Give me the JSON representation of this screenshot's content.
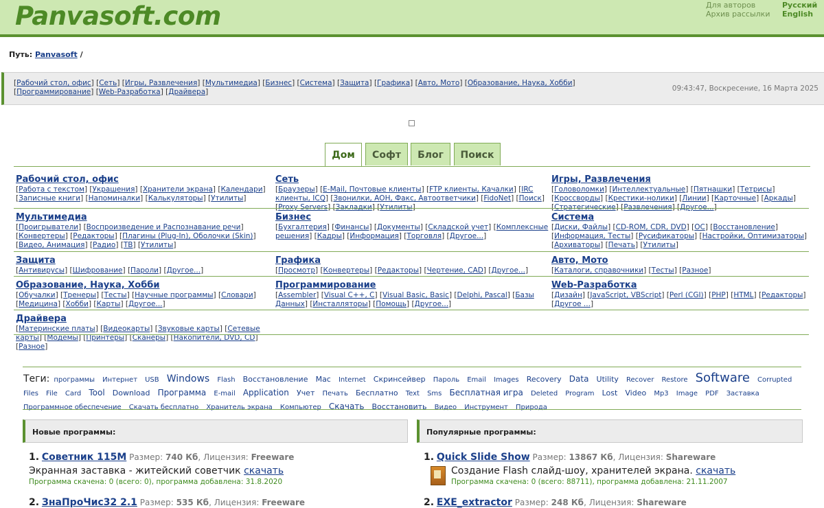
{
  "header": {
    "logo": "Panvasoft.com",
    "links": [
      "Для авторов",
      "Архив рассылки"
    ],
    "languages": [
      "Русский",
      "English"
    ]
  },
  "path": {
    "label": "Путь:",
    "link": "Panvasoft",
    "sep": "/"
  },
  "catbar": {
    "links": [
      "Рабочий стол, офис",
      "Сеть",
      "Игры, Развлечения",
      "Мультимедиа",
      "Бизнес",
      "Система",
      "Защита",
      "Графика",
      "Авто, Мото",
      "Образование, Наука, Хобби",
      "Программирование",
      "Web-Разработка",
      "Драйвера"
    ],
    "datetime": "09:43:47, Воскресение, 16 Марта 2025"
  },
  "tabs": [
    "Дом",
    "Софт",
    "Блог",
    "Поиск"
  ],
  "categories": [
    {
      "title": "Рабочий стол, офис",
      "items": [
        "Работа с текстом",
        "Украшения",
        "Хранители экрана",
        "Календари",
        "Записные книги",
        "Напоминалки",
        "Калькуляторы",
        "Утилиты"
      ]
    },
    {
      "title": "Сеть",
      "items": [
        "Браузеры",
        "E-Mail, Почтовые клиенты",
        "FTP клиенты, Качалки",
        "IRC клиенты, ICQ",
        "Звонилки, АОН, Факс, Автоответчики",
        "FidoNet",
        "Поиск",
        "Proxy Servers",
        "Закладки",
        "Утилиты"
      ]
    },
    {
      "title": "Игры, Развлечения",
      "items": [
        "Головоломки",
        "Интеллектуальные",
        "Пятнашки",
        "Тетрисы",
        "Кроссворды",
        "Крестики-нолики",
        "Линии",
        "Карточные",
        "Аркады",
        "Стратегические",
        "Развлечения",
        "Другое..."
      ]
    },
    {
      "title": "Мультимедиа",
      "items": [
        "Проигрыватели",
        "Воспроизведение и Распознавание речи",
        "Конвертеры",
        "Редакторы",
        "Плагины (Plug-In), Оболочки (Skin)",
        "Видео, Анимация",
        "Радио",
        "ТВ",
        "Утилиты"
      ]
    },
    {
      "title": "Бизнес",
      "items": [
        "Бухгалтерия",
        "Финансы",
        "Документы",
        "Складской учет",
        "Комплексные решения",
        "Кадры",
        "Информация",
        "Торговля",
        "Другое..."
      ]
    },
    {
      "title": "Система",
      "items": [
        "Диски, Файлы",
        "CD-ROM, CDR, DVD",
        "ОС",
        "Восстановление",
        "Информация, Тесты",
        "Русификаторы",
        "Настройки, Оптимизаторы",
        "Архиваторы",
        "Печать",
        "Утилиты"
      ]
    },
    {
      "title": "Защита",
      "items": [
        "Антивирусы",
        "Шифрование",
        "Пароли",
        "Другое..."
      ]
    },
    {
      "title": "Графика",
      "items": [
        "Просмотр",
        "Конвертеры",
        "Редакторы",
        "Чертение, CAD",
        "Другое..."
      ]
    },
    {
      "title": "Авто, Мото",
      "items": [
        "Каталоги, справочники",
        "Тесты",
        "Разное"
      ]
    },
    {
      "title": "Образование, Наука, Хобби",
      "items": [
        "Обучалки",
        "Тренеры",
        "Тесты",
        "Научные программы",
        "Словари",
        "Медицина",
        "Хобби",
        "Карты",
        "Другое..."
      ]
    },
    {
      "title": "Программирование",
      "items": [
        "Assembler",
        "Visual C++, C",
        "Visual Basic, Basic",
        "Delphi, Pascal",
        "Базы Данных",
        "Инсталляторы",
        "Помощь",
        "Другое..."
      ]
    },
    {
      "title": "Web-Разработка",
      "items": [
        "Дизайн",
        "JavaScript, VBScript",
        "Perl (CGI)",
        "PHP",
        "HTML",
        "Редакторы",
        "Другое ..."
      ]
    },
    {
      "title": "Драйвера",
      "items": [
        "Материнские платы",
        "Видеокарты",
        "Звуковые карты",
        "Сетевые карты",
        "Модемы",
        "Принтеры",
        "Сканеры",
        "Накопители, DVD, CD",
        "Разное"
      ]
    }
  ],
  "tags": {
    "label": "Теги:",
    "items": [
      {
        "t": "программы",
        "s": 10
      },
      {
        "t": "Интернет",
        "s": 10
      },
      {
        "t": "USB",
        "s": 10
      },
      {
        "t": "Windows",
        "s": 14
      },
      {
        "t": "Flash",
        "s": 10
      },
      {
        "t": "Восстановление",
        "s": 11
      },
      {
        "t": "Mac",
        "s": 11
      },
      {
        "t": "Internet",
        "s": 10
      },
      {
        "t": "Скринсейвер",
        "s": 11
      },
      {
        "t": "Пароль",
        "s": 10
      },
      {
        "t": "Email",
        "s": 10
      },
      {
        "t": "Images",
        "s": 10
      },
      {
        "t": "Recovery",
        "s": 11
      },
      {
        "t": "Data",
        "s": 12
      },
      {
        "t": "Utility",
        "s": 11
      },
      {
        "t": "Recover",
        "s": 10
      },
      {
        "t": "Restore",
        "s": 10
      },
      {
        "t": "Software",
        "s": 18
      },
      {
        "t": "Corrupted",
        "s": 10
      },
      {
        "t": "Files",
        "s": 10
      },
      {
        "t": "File",
        "s": 10
      },
      {
        "t": "Card",
        "s": 10
      },
      {
        "t": "Tool",
        "s": 12
      },
      {
        "t": "Download",
        "s": 11
      },
      {
        "t": "Программа",
        "s": 12
      },
      {
        "t": "E-mail",
        "s": 10
      },
      {
        "t": "Application",
        "s": 12
      },
      {
        "t": "Учет",
        "s": 11
      },
      {
        "t": "Печать",
        "s": 10
      },
      {
        "t": "Бесплатно",
        "s": 11
      },
      {
        "t": "Text",
        "s": 10
      },
      {
        "t": "Sms",
        "s": 10
      },
      {
        "t": "Бесплатная игра",
        "s": 12
      },
      {
        "t": "Deleted",
        "s": 10
      },
      {
        "t": "Program",
        "s": 10
      },
      {
        "t": "Lost",
        "s": 11
      },
      {
        "t": "Video",
        "s": 11
      },
      {
        "t": "Mp3",
        "s": 10
      },
      {
        "t": "Image",
        "s": 10
      },
      {
        "t": "PDF",
        "s": 10
      },
      {
        "t": "Заставка",
        "s": 10
      },
      {
        "t": "Программное обеспечение",
        "s": 10
      },
      {
        "t": "Скачать бесплатно",
        "s": 10
      },
      {
        "t": "Хранитель экрана",
        "s": 10
      },
      {
        "t": "Компьютер",
        "s": 10
      },
      {
        "t": "Скачать",
        "s": 12
      },
      {
        "t": "Восстановить",
        "s": 11
      },
      {
        "t": "Видео",
        "s": 10
      },
      {
        "t": "Инструмент",
        "s": 10
      },
      {
        "t": "Природа",
        "s": 10
      }
    ]
  },
  "new_programs": {
    "heading": "Новые программы:",
    "items": [
      {
        "num": "1.",
        "name": "Советник 115M",
        "size_label": "Размер:",
        "size": "740 Кб",
        "lic_label": "Лицензия:",
        "license": "Freeware",
        "desc": "Экранная заставка - житейский советчик",
        "dl": "скачать",
        "stat": "Программа скачена: 0 (всего: 0), программа добавлена: 31.8.2020"
      },
      {
        "num": "2.",
        "name": "ЗнаПроЧис32 2.1",
        "size_label": "Размер:",
        "size": "535 Кб",
        "lic_label": "Лицензия:",
        "license": "Freeware"
      }
    ]
  },
  "popular_programs": {
    "heading": "Популярные программы:",
    "items": [
      {
        "num": "1.",
        "name": "Quick Slide Show",
        "size_label": "Размер:",
        "size": "13867 Кб",
        "lic_label": "Лицензия:",
        "license": "Shareware",
        "desc": "Создание Flash слайд-шоу, хранителей экрана.",
        "dl": "скачать",
        "stat": "Программа скачена: 0 (всего: 88711), программа добавлена: 21.11.2007"
      },
      {
        "num": "2.",
        "name": "EXE_extractor",
        "size_label": "Размер:",
        "size": "248 Кб",
        "lic_label": "Лицензия:",
        "license": "Shareware"
      }
    ]
  }
}
